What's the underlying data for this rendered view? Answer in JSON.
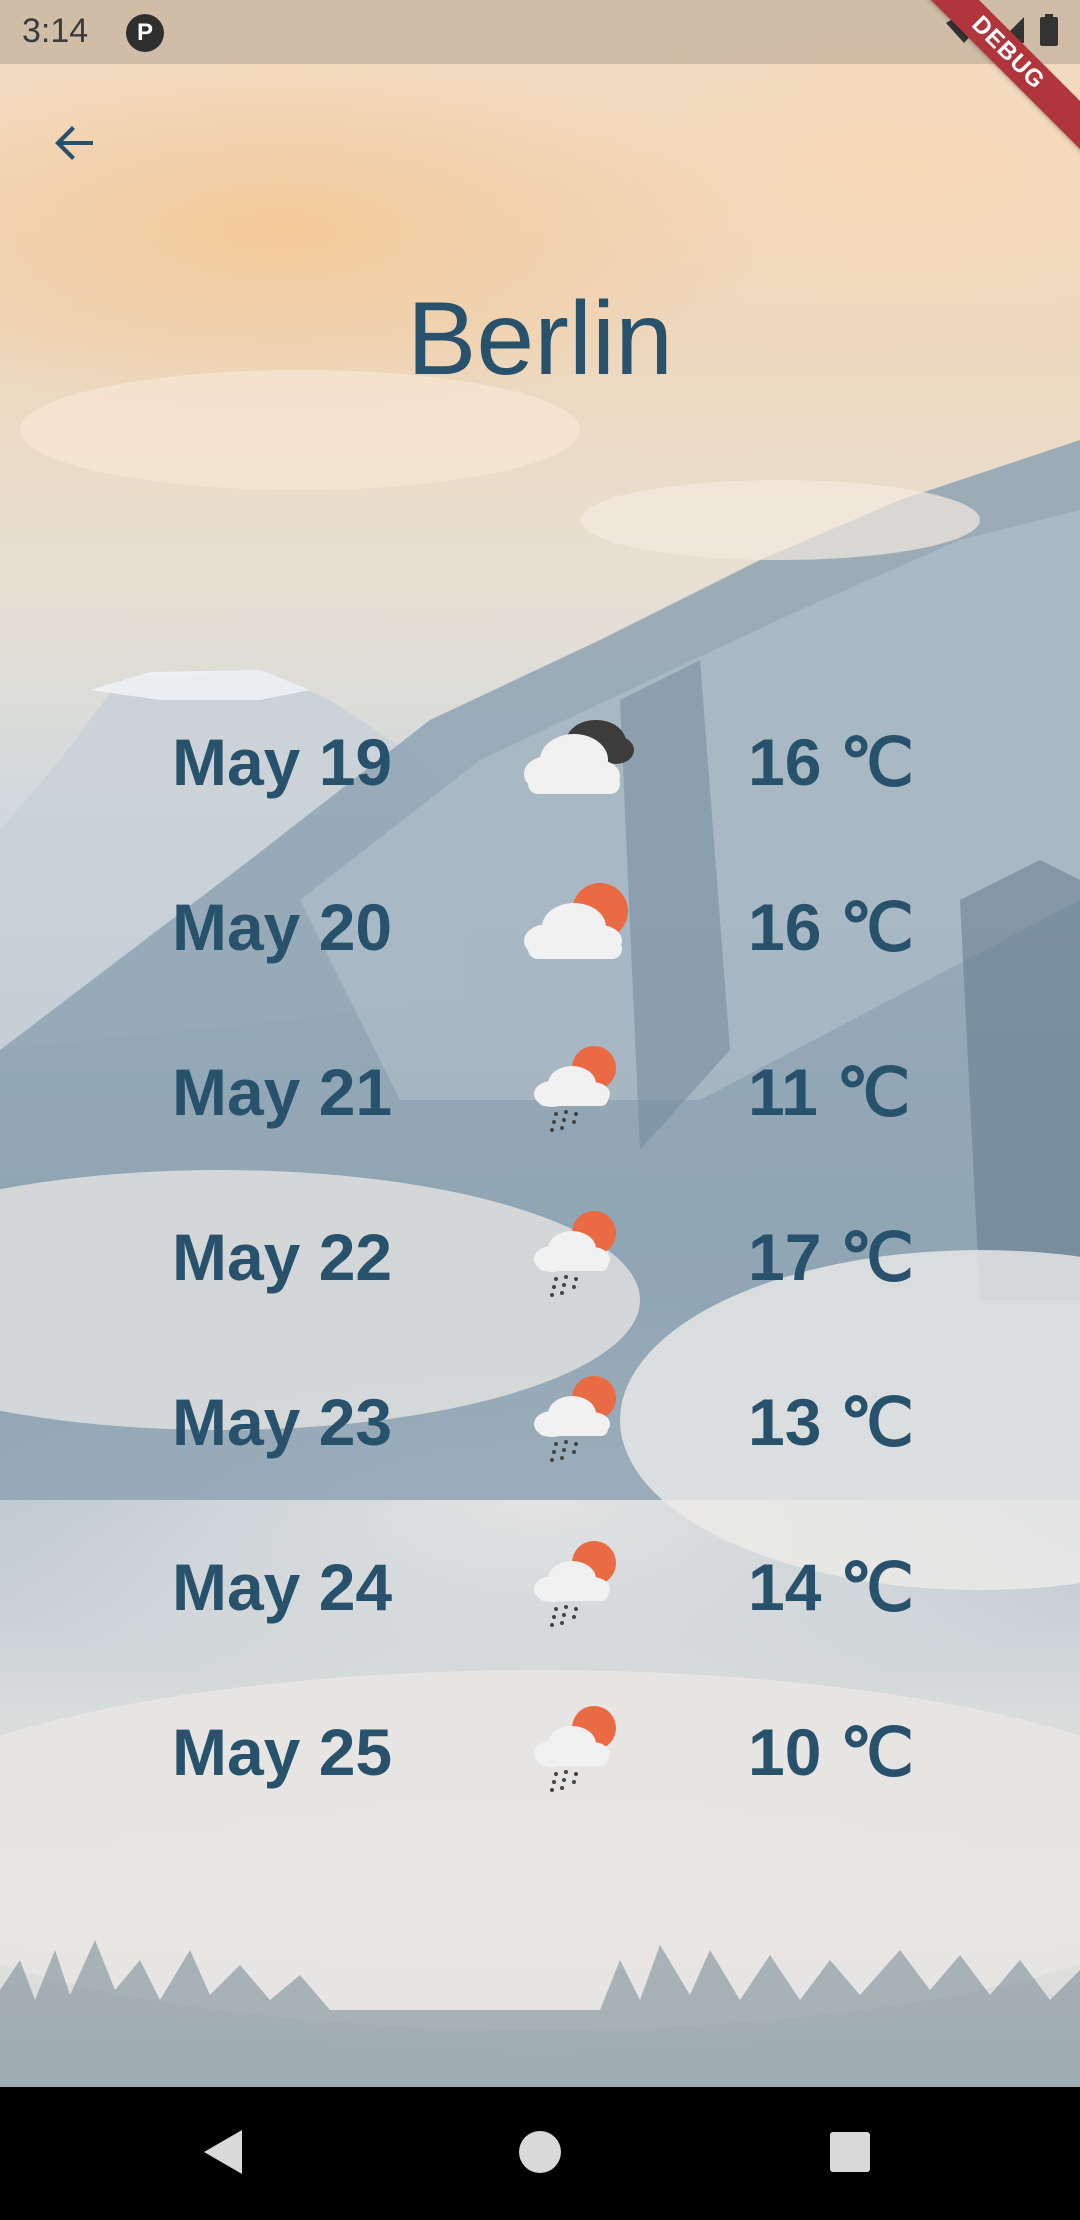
{
  "status_bar": {
    "time": "3:14",
    "app_badge": "P"
  },
  "debug_banner": "DEBUG",
  "header": {
    "back_icon": "arrow-back-icon",
    "city": "Berlin"
  },
  "forecast": [
    {
      "date": "May 19",
      "icon": "cloudy-dark-icon",
      "temp": "16 ℃"
    },
    {
      "date": "May 20",
      "icon": "partly-sunny-icon",
      "temp": "16 ℃"
    },
    {
      "date": "May 21",
      "icon": "sun-rain-icon",
      "temp": "11 ℃"
    },
    {
      "date": "May 22",
      "icon": "sun-rain-icon",
      "temp": "17 ℃"
    },
    {
      "date": "May 23",
      "icon": "sun-rain-icon",
      "temp": "13 ℃"
    },
    {
      "date": "May 24",
      "icon": "sun-rain-icon",
      "temp": "14 ℃"
    },
    {
      "date": "May 25",
      "icon": "sun-rain-icon",
      "temp": "10 ℃"
    }
  ],
  "colors": {
    "text": "#28526b",
    "sun": "#ea6a43",
    "cloud": "#f1f1f1",
    "dark_cloud": "#3c3c3c",
    "debug": "#b0353c"
  },
  "nav": {
    "back": "nav-back-icon",
    "home": "nav-home-icon",
    "recents": "nav-recents-icon"
  }
}
